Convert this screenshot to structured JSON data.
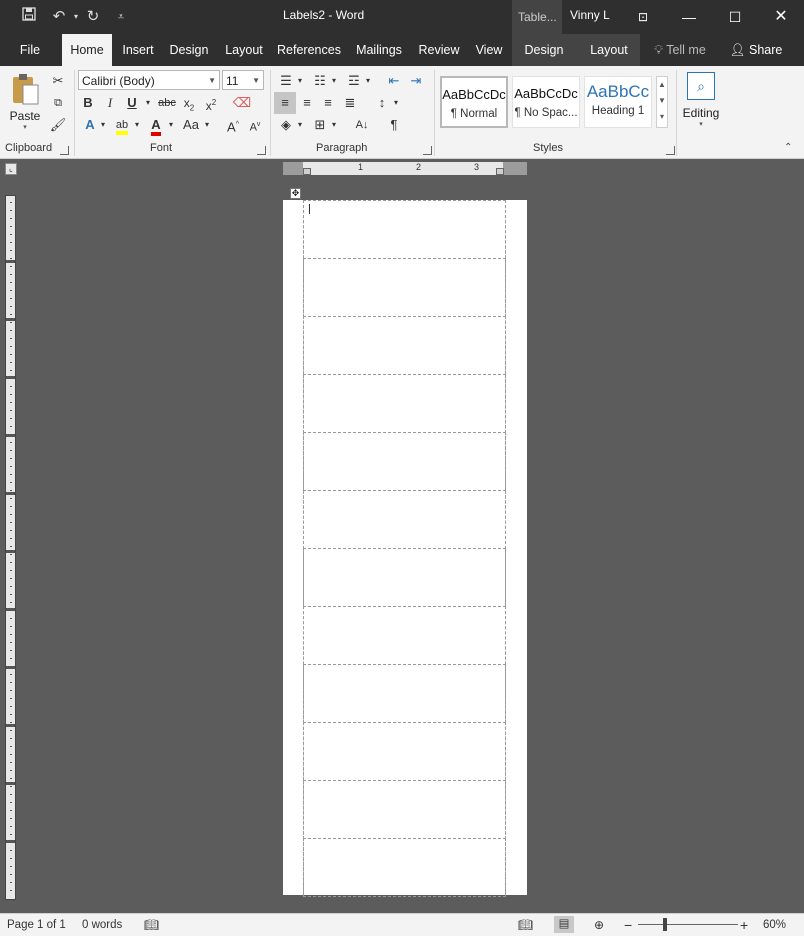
{
  "titlebar": {
    "document_title": "Labels2 - Word",
    "table_tools": "Table...",
    "user": "Vinny L",
    "icons": [
      "save-icon",
      "undo-icon",
      "redo-icon",
      "customize-qat-icon",
      "ribbon-display-icon",
      "minimize-icon",
      "maximize-icon",
      "close-icon"
    ]
  },
  "tabs": {
    "file": "File",
    "home": "Home",
    "insert": "Insert",
    "design": "Design",
    "layout": "Layout",
    "references": "References",
    "mailings": "Mailings",
    "review": "Review",
    "view": "View",
    "table_design": "Design",
    "table_layout": "Layout",
    "tell_me": "Tell me",
    "share": "Share"
  },
  "ribbon": {
    "clipboard": {
      "label": "Clipboard",
      "paste": "Paste"
    },
    "font": {
      "label": "Font",
      "font_name": "Calibri (Body)",
      "font_size": "11",
      "change_case": "Aa"
    },
    "paragraph": {
      "label": "Paragraph"
    },
    "styles": {
      "label": "Styles",
      "items": [
        {
          "sample": "AaBbCcDc",
          "name": "¶ Normal"
        },
        {
          "sample": "AaBbCcDc",
          "name": "¶ No Spac..."
        },
        {
          "sample": "AaBbCc",
          "name": "Heading 1"
        }
      ]
    },
    "editing": {
      "label": "Editing"
    }
  },
  "ruler": {
    "marks": [
      "1",
      "2",
      "3"
    ]
  },
  "document": {
    "label_rows": 12
  },
  "statusbar": {
    "page": "Page 1 of 1",
    "words": "0 words",
    "zoom": "60%"
  },
  "colors": {
    "highlight": "#ffff00",
    "font_color": "#e00000",
    "heading_blue": "#2e74b5"
  }
}
